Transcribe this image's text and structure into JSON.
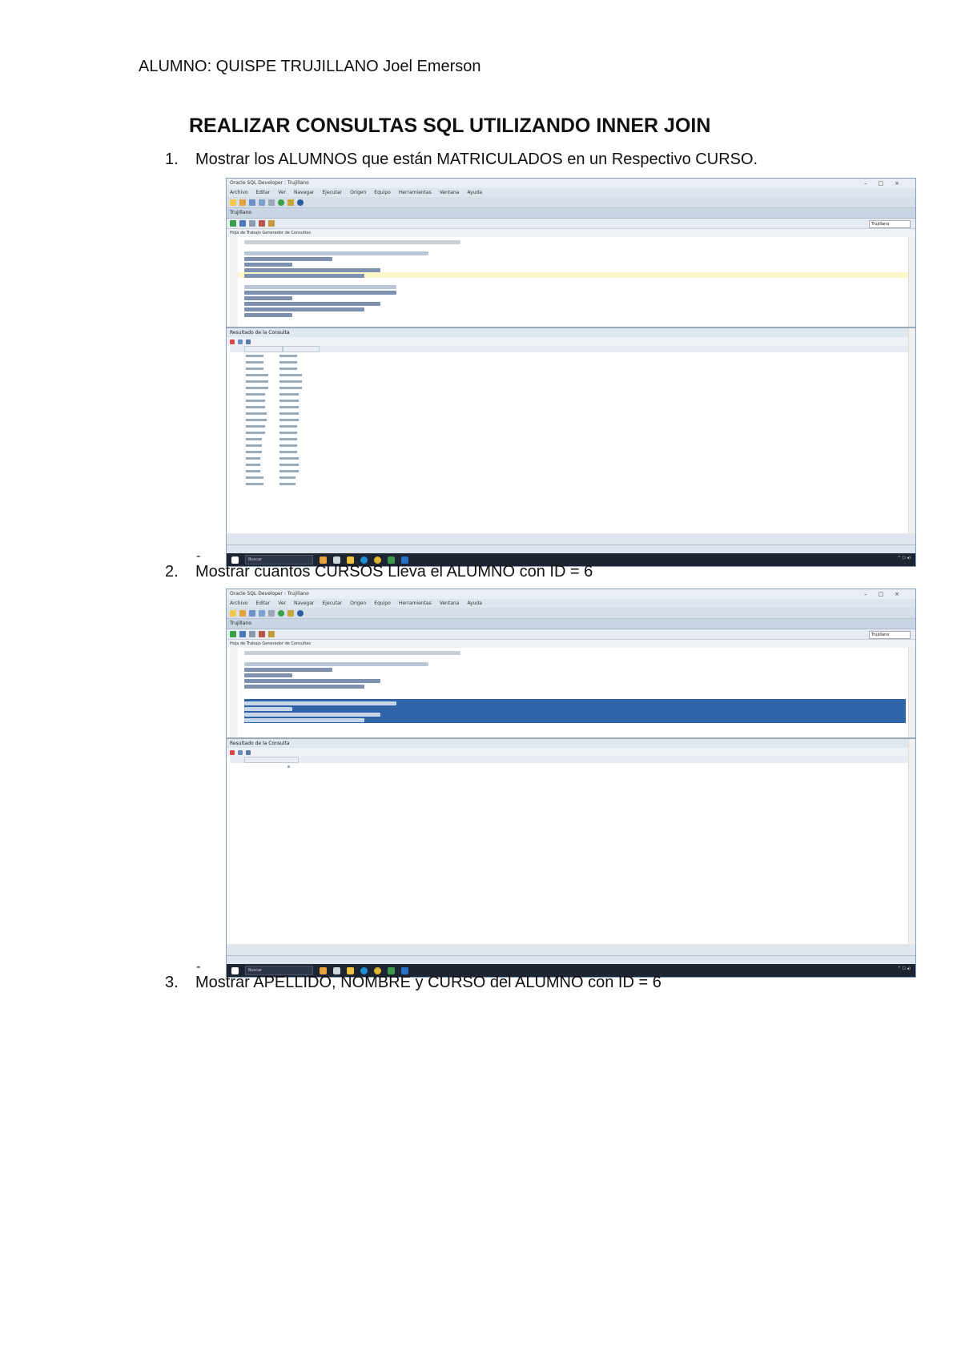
{
  "header": {
    "student": "ALUMNO: QUISPE TRUJILLANO Joel Emerson",
    "title": "REALIZAR CONSULTAS SQL UTILIZANDO INNER JOIN"
  },
  "items": [
    {
      "num": "1.",
      "text": "Mostrar los ALUMNOS que están MATRICULADOS en un Respectivo CURSO."
    },
    {
      "num": "2.",
      "text": "Mostrar cuantos CURSOS Lleva el ALUMNO con ID = 6"
    },
    {
      "num": "3.",
      "text": "Mostrar APELLIDO, NOMBRE y CURSO del ALUMNO con ID = 6"
    }
  ],
  "dash": "-",
  "screenshot": {
    "window_title": "Oracle SQL Developer : Trujillano",
    "menu": [
      "Archivo",
      "Editar",
      "Ver",
      "Navegar",
      "Ejecutar",
      "Origen",
      "Equipo",
      "Herramientas",
      "Ventana",
      "Ayuda"
    ],
    "tab": "Trujillano",
    "subtabs": "Hoja de Trabajo    Generador de Consultas",
    "result_tab": "Resultado de la Consulta",
    "taskbar_search": "Buscar",
    "colors": {
      "selection": "#2f64a6",
      "taskbar": "#1d2533"
    }
  }
}
